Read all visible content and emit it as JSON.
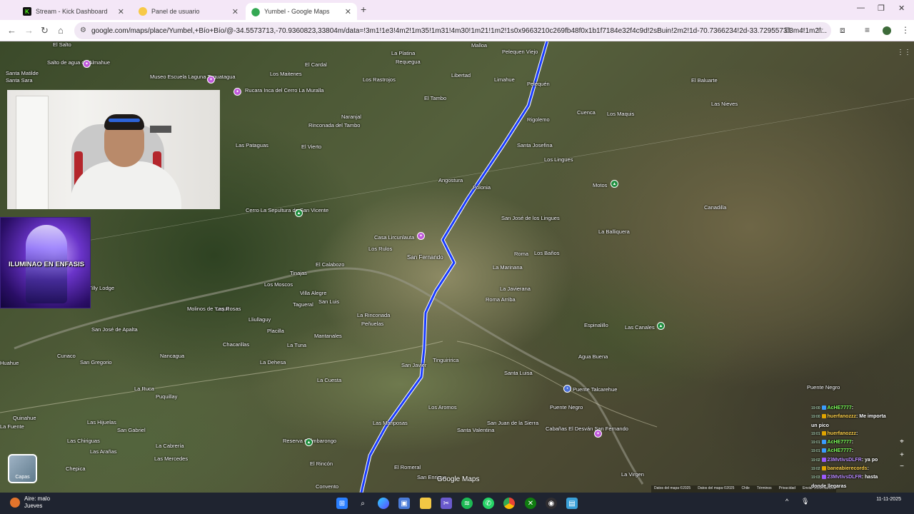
{
  "browser": {
    "tabs": [
      {
        "label": "Stream - Kick Dashboard",
        "icon": "kick-icon",
        "active": false
      },
      {
        "label": "Panel de usuario",
        "icon": "yellow-dot-icon",
        "active": false
      },
      {
        "label": "Yumbel - Google Maps",
        "icon": "maps-pin-icon",
        "active": true
      }
    ],
    "url": "google.com/maps/place/Yumbel,+Bío+Bío/@-34.5573713,-70.9360823,33804m/data=!3m1!1e3!4m2!1m35!1m31!4m30!1m21!1m2!1s0x9663210c269fb48f0x1b1f7184e32f4c9d!2sBuin!2m2!1d-70.7366234!2d-33.7295573!3m4!1m2!..."
  },
  "map": {
    "places": [
      {
        "name": "El Salto",
        "cls": ""
      },
      {
        "name": "Salto de agua de Almahue",
        "cls": ""
      },
      {
        "name": "Santa Matilde",
        "cls": ""
      },
      {
        "name": "Santa Sara",
        "cls": ""
      },
      {
        "name": "Museo Escuela Laguna Taguatagua",
        "cls": ""
      },
      {
        "name": "Rucara Inca del Cerro La Muralla",
        "cls": ""
      },
      {
        "name": "Los Maitenes",
        "cls": ""
      },
      {
        "name": "El Cardal",
        "cls": ""
      },
      {
        "name": "La Platina",
        "cls": ""
      },
      {
        "name": "Requegua",
        "cls": ""
      },
      {
        "name": "Malloa",
        "cls": ""
      },
      {
        "name": "Pelequen Viejo",
        "cls": ""
      },
      {
        "name": "Los Rastrojos",
        "cls": ""
      },
      {
        "name": "Libertad",
        "cls": ""
      },
      {
        "name": "Limahue",
        "cls": ""
      },
      {
        "name": "Pelequén",
        "cls": ""
      },
      {
        "name": "El Tambo",
        "cls": ""
      },
      {
        "name": "Naranjal",
        "cls": ""
      },
      {
        "name": "Rinconada del Tambo",
        "cls": ""
      },
      {
        "name": "Las Pataguas",
        "cls": ""
      },
      {
        "name": "El Vierto",
        "cls": ""
      },
      {
        "name": "Rigolemo",
        "cls": ""
      },
      {
        "name": "Cuenca",
        "cls": ""
      },
      {
        "name": "Los Maquis",
        "cls": ""
      },
      {
        "name": "Las Nieves",
        "cls": ""
      },
      {
        "name": "El Baluarte",
        "cls": ""
      },
      {
        "name": "Santa Josefina",
        "cls": ""
      },
      {
        "name": "Los Lingues",
        "cls": ""
      },
      {
        "name": "Angostura",
        "cls": ""
      },
      {
        "name": "Polonia",
        "cls": ""
      },
      {
        "name": "Motos",
        "cls": ""
      },
      {
        "name": "Canadilla",
        "cls": ""
      },
      {
        "name": "Cerro La Sepultura de San Vicente",
        "cls": ""
      },
      {
        "name": "San José de los Lingues",
        "cls": ""
      },
      {
        "name": "Casa Lircunlauta",
        "cls": ""
      },
      {
        "name": "Los Rulos",
        "cls": ""
      },
      {
        "name": "San Fernando",
        "cls": "big"
      },
      {
        "name": "Roma",
        "cls": ""
      },
      {
        "name": "Los Baños",
        "cls": ""
      },
      {
        "name": "La Balliquera",
        "cls": ""
      },
      {
        "name": "Tinajas",
        "cls": ""
      },
      {
        "name": "El Calabozo",
        "cls": ""
      },
      {
        "name": "Puente Negro",
        "cls": ""
      },
      {
        "name": "La Marinana",
        "cls": ""
      },
      {
        "name": "Los Moscos",
        "cls": ""
      },
      {
        "name": "Villa Alegre",
        "cls": ""
      },
      {
        "name": "La Javierana",
        "cls": ""
      },
      {
        "name": "Tagueral",
        "cls": ""
      },
      {
        "name": "San Luis",
        "cls": ""
      },
      {
        "name": "Roma Arriba",
        "cls": ""
      },
      {
        "name": "Molinos de Yaquil",
        "cls": ""
      },
      {
        "name": "Las Rosas",
        "cls": ""
      },
      {
        "name": "Lliullaguy",
        "cls": ""
      },
      {
        "name": "La Rinconada",
        "cls": ""
      },
      {
        "name": "Peñuelas",
        "cls": ""
      },
      {
        "name": "Espinalillo",
        "cls": ""
      },
      {
        "name": "Las Canales",
        "cls": ""
      },
      {
        "name": "San José de Apalta",
        "cls": ""
      },
      {
        "name": "Placilla",
        "cls": ""
      },
      {
        "name": "Mantanales",
        "cls": ""
      },
      {
        "name": "Chacarillas",
        "cls": ""
      },
      {
        "name": "La Tuna",
        "cls": ""
      },
      {
        "name": "Agua Buena",
        "cls": ""
      },
      {
        "name": "Cunaco",
        "cls": ""
      },
      {
        "name": "Nancagua",
        "cls": ""
      },
      {
        "name": "La Dehesa",
        "cls": ""
      },
      {
        "name": "Tinguiririca",
        "cls": ""
      },
      {
        "name": "San Gregorio",
        "cls": ""
      },
      {
        "name": "San Javier",
        "cls": ""
      },
      {
        "name": "Santa Luisa",
        "cls": ""
      },
      {
        "name": "Puente Talcarehue",
        "cls": ""
      },
      {
        "name": "La Cuesta",
        "cls": ""
      },
      {
        "name": "La Ruca",
        "cls": ""
      },
      {
        "name": "Puquillay",
        "cls": ""
      },
      {
        "name": "Quinahue",
        "cls": ""
      },
      {
        "name": "Los Aromos",
        "cls": ""
      },
      {
        "name": "Puente Negro",
        "cls": ""
      },
      {
        "name": "La Fuente",
        "cls": ""
      },
      {
        "name": "Las Hijuelas",
        "cls": ""
      },
      {
        "name": "Las Mariposas",
        "cls": ""
      },
      {
        "name": "San Juan de la Sierra",
        "cls": ""
      },
      {
        "name": "Cabañas El Desván San Fernando",
        "cls": ""
      },
      {
        "name": "San Gabriel",
        "cls": ""
      },
      {
        "name": "Las Chiriguas",
        "cls": ""
      },
      {
        "name": "Las Arañas",
        "cls": ""
      },
      {
        "name": "Santa Valentina",
        "cls": ""
      },
      {
        "name": "La Cabrería",
        "cls": ""
      },
      {
        "name": "Reserva Chimbarongo",
        "cls": ""
      },
      {
        "name": "Las Mercedes",
        "cls": ""
      },
      {
        "name": "Chepica",
        "cls": ""
      },
      {
        "name": "El Rincón",
        "cls": ""
      },
      {
        "name": "El Romeral",
        "cls": ""
      },
      {
        "name": "San Enrique",
        "cls": ""
      },
      {
        "name": "La Virgen",
        "cls": ""
      },
      {
        "name": "Convento",
        "cls": ""
      },
      {
        "name": "Tilly Lodge",
        "cls": ""
      },
      {
        "name": "Huahue",
        "cls": ""
      }
    ],
    "layers_label": "Capas",
    "logo": "Google Maps",
    "attribution": [
      "Datos del mapa ©2025",
      "Datos del mapa ©2025",
      "Chile",
      "Términos",
      "Privacidad",
      "Enviar comentarios"
    ]
  },
  "stream": {
    "promo_title": "ILUMINAO EN ENFASIS",
    "chat": [
      {
        "time": "19:00",
        "user": "AcHE7777",
        "text": ":",
        "badge": "#3a9cff",
        "ucolor": "#7cff5a"
      },
      {
        "time": "19:00",
        "user": "huerfanozzz",
        "text": ": Me importa",
        "badge": "#e0a400",
        "ucolor": "#ffd24a"
      },
      {
        "time": "",
        "user": "",
        "text": "un pico",
        "badge": "",
        "ucolor": "#fff"
      },
      {
        "time": "19:01",
        "user": "huerfanozzz",
        "text": ":",
        "badge": "#e0a400",
        "ucolor": "#ffd24a"
      },
      {
        "time": "19:01",
        "user": "AcHE7777",
        "text": ":",
        "badge": "#3a9cff",
        "ucolor": "#7cff5a"
      },
      {
        "time": "19:01",
        "user": "AcHE7777",
        "text": ":",
        "badge": "#3a9cff",
        "ucolor": "#7cff5a"
      },
      {
        "time": "19:02",
        "user": "23MvtivsDLFR",
        "text": ": ya po",
        "badge": "#9b59ff",
        "ucolor": "#b98bff"
      },
      {
        "time": "19:02",
        "user": "baneabierecords",
        "text": ":",
        "badge": "#e0a400",
        "ucolor": "#ffd24a"
      },
      {
        "time": "19:03",
        "user": "23MvtivsDLFR",
        "text": ": hasta",
        "badge": "#9b59ff",
        "ucolor": "#b98bff"
      },
      {
        "time": "",
        "user": "",
        "text": "donde llegaras",
        "badge": "",
        "ucolor": "#fff"
      }
    ]
  },
  "taskbar": {
    "weather_line1": "Aire: malo",
    "weather_line2": "Jueves",
    "clock_time": "",
    "clock_date": "11-11-2025",
    "apps": [
      "windows-start-icon",
      "search-icon",
      "copilot-icon",
      "edge-icon",
      "store-icon",
      "file-explorer-icon",
      "snipping-tool-icon",
      "spotify-icon",
      "whatsapp-icon",
      "chrome-icon",
      "xbox-icon",
      "obs-icon",
      "notepad-icon"
    ]
  }
}
